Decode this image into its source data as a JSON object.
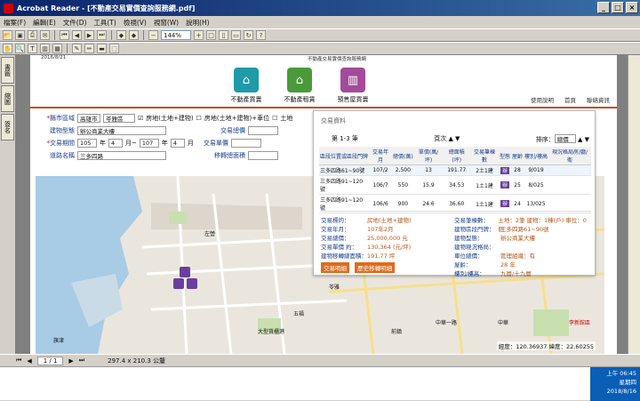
{
  "window": {
    "title": "Acrobat Reader - [不動產交易實價查詢服務網.pdf]",
    "min": "_",
    "max": "□",
    "close": "×"
  },
  "menu": [
    "檔案(F)",
    "編輯(E)",
    "文件(D)",
    "工具(T)",
    "檢視(V)",
    "視窗(W)",
    "說明(H)"
  ],
  "toolbar": {
    "zoom": "144%"
  },
  "sidetabs": [
    "書籤",
    "縮圖",
    "簽名"
  ],
  "page": {
    "date": "2016/8/21",
    "header_title": "不動產交易實價查詢服務網",
    "nav": [
      {
        "label": "不動產買賣",
        "color": "#1f9aa8"
      },
      {
        "label": "不動產租賃",
        "color": "#4a9a3a"
      },
      {
        "label": "預售屋買賣",
        "color": "#a34a9a"
      }
    ],
    "links": [
      "使用說明",
      "首頁",
      "聯絡資訊"
    ],
    "form": {
      "county_label": "縣市區域",
      "county": "高雄市",
      "district": "苓雅區",
      "opt1": "房地(土地+建物)",
      "opt2": "房地(土地+建物)+車位",
      "opt3": "土地",
      "building_label": "建物型態",
      "building": "辦公商業大樓",
      "period_label": "交易期間",
      "y1": "105",
      "m_label": "年",
      "m1": "4",
      "tilde": "月~",
      "y2": "107",
      "m2": "4",
      "month": "月",
      "road_label": "道路名稱",
      "road": "三多四路",
      "total_label": "交易總價",
      "unit_label": "交易單價",
      "area_label": "移轉總面積"
    },
    "popup": {
      "title": "交易資料",
      "range": "第 1-3 筆",
      "pages": "頁次",
      "sort": "排序：",
      "sort_val": "總價",
      "headers": [
        "區段位置或區段門牌",
        "交易年月",
        "總價(萬)",
        "單價(萬/坪)",
        "總面積(坪)",
        "交易筆棟數",
        "型態",
        "屋齡",
        "樓別/樓高",
        "現況格局房/廳/衛"
      ],
      "rows": [
        [
          "三多四路61~90號",
          "107/2",
          "2,500",
          "13",
          "191.77",
          "2土1建",
          "辦",
          "28",
          "9/019",
          ""
        ],
        [
          "三多四路91~120號",
          "106/7",
          "550",
          "15.9",
          "34.53",
          "1土1建",
          "辦",
          "25",
          "8/025",
          ""
        ],
        [
          "三多四路91~120號",
          "106/6",
          "900",
          "24.6",
          "36.60",
          "1土1建",
          "辦",
          "24",
          "13/025",
          ""
        ]
      ],
      "detail_left": [
        [
          "交易標的：",
          "房地(土地+建物)"
        ],
        [
          "交易年月：",
          "107年2月"
        ],
        [
          "交易總價：",
          "25,000,000 元"
        ],
        [
          "交易單價 約：",
          "130,364 (元/坪)"
        ],
        [
          "建物移轉總面積：",
          "191.77 坪"
        ]
      ],
      "detail_right": [
        [
          "交易筆棟數：",
          "土地：2筆 建物：1棟(戶) 車位：0個"
        ],
        [
          "建物區段門牌：",
          "三多四路61~90號"
        ],
        [
          "建物型態：",
          "辦公商業大樓"
        ],
        [
          "建物現況格局：",
          ""
        ],
        [
          "車位總價：",
          "管理組織：有"
        ],
        [
          "屋齡：",
          "28 年"
        ],
        [
          "樓別/樓高：",
          "九層/十九層"
        ]
      ],
      "btn1": "交易明細",
      "btn2": "歷史移轉明細"
    },
    "map": {
      "coord": "經度：120.36937  緯度：22.60255",
      "labels": [
        "大型貨櫃港",
        "左營",
        "苓雅",
        "前鎮",
        "旗津",
        "中華一路",
        "五福",
        "中華",
        "李新館區"
      ]
    }
  },
  "status": {
    "page": "1 / 1",
    "size": "297.4 x 210.3 公釐"
  },
  "tray": {
    "time": "上午 06:45",
    "weekday": "星期四",
    "date": "2018/8/16"
  }
}
